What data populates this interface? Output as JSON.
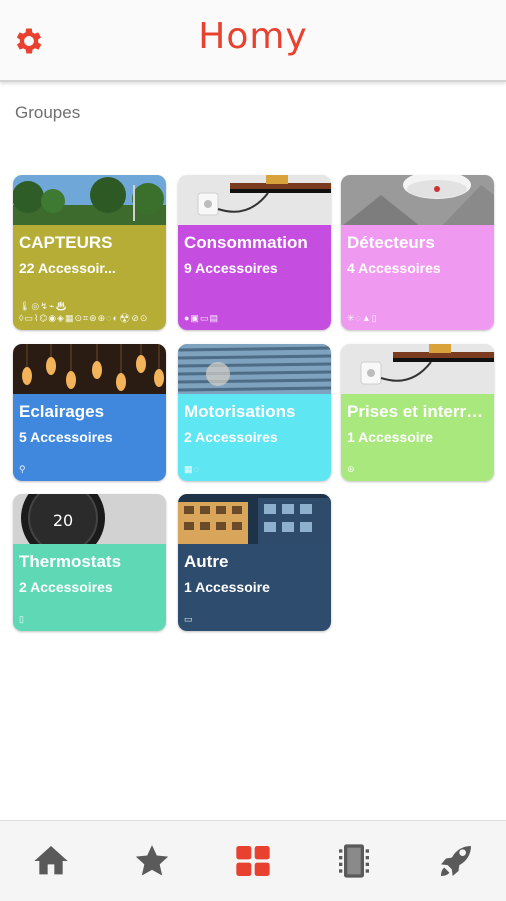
{
  "header": {
    "title": "Homy",
    "settings_icon": "gear-icon",
    "accent_color": "#e8412f"
  },
  "section": {
    "label": "Groupes"
  },
  "groups": [
    {
      "title": "CAPTEURS",
      "count": "22 Accessoir...",
      "color": "#b5ad35",
      "icons": "🌡◎↯⌁♨◊▭⌇⌬◉◈▦⊙⌗⊛⊕◌◐☢⊘⊙"
    },
    {
      "title": "Consommation",
      "count": "9 Accessoires",
      "color": "#c54ee0",
      "icons": "●▣▭▤"
    },
    {
      "title": "Détecteurs",
      "count": "4 Accessoires",
      "color": "#ef9af0",
      "icons": "✳◌▲▯"
    },
    {
      "title": "Eclairages",
      "count": "5 Accessoires",
      "color": "#3f88de",
      "icons": "⚲"
    },
    {
      "title": "Motorisations",
      "count": "2 Accessoires",
      "color": "#5ee6f2",
      "icons": "▦◌"
    },
    {
      "title": "Prises et interru...",
      "count": "1 Accessoire",
      "color": "#a9e87c",
      "icons": "⊛"
    },
    {
      "title": "Thermostats",
      "count": "2 Accessoires",
      "color": "#5fd8b5",
      "icons": "▯"
    },
    {
      "title": "Autre",
      "count": "1 Accessoire",
      "color": "#2e4c6e",
      "icons": "▭"
    }
  ],
  "thermostat_display": "20",
  "bottom_nav": {
    "items": [
      {
        "icon": "home-icon",
        "active": false
      },
      {
        "icon": "star-icon",
        "active": false
      },
      {
        "icon": "grid-icon",
        "active": true
      },
      {
        "icon": "device-icon",
        "active": false
      },
      {
        "icon": "rocket-icon",
        "active": false
      }
    ],
    "active_color": "#e8412f",
    "inactive_color": "#5a5a5a"
  }
}
